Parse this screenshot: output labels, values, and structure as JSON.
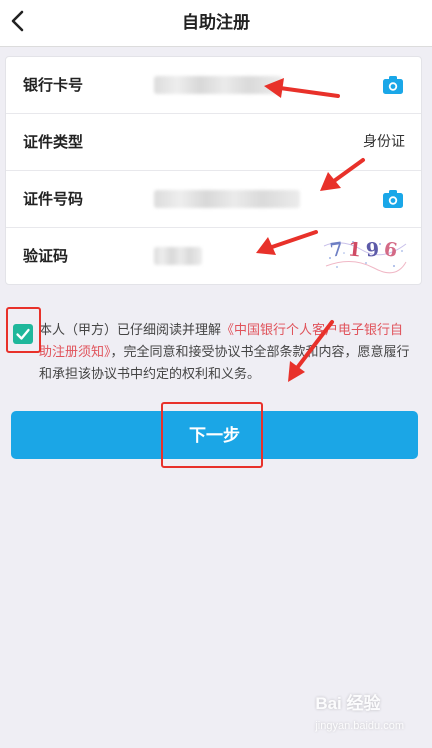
{
  "header": {
    "title": "自助注册",
    "back_icon": "chevron-left-icon"
  },
  "form": {
    "rows": [
      {
        "label": "银行卡号",
        "value": "",
        "icon": "camera-icon"
      },
      {
        "label": "证件类型",
        "value": "身份证"
      },
      {
        "label": "证件号码",
        "value": "",
        "icon": "camera-icon"
      },
      {
        "label": "验证码",
        "value": "",
        "captcha": "7196"
      }
    ]
  },
  "agreement": {
    "checked": true,
    "text_before": "本人（甲方）已仔细阅读并理解",
    "link_text": "《中国银行个人客户电子银行自助注册须知》",
    "text_after": "，完全同意和接受协议书全部条款和内容，愿意履行和承担该协议书中约定的权利和义务。"
  },
  "next_button": {
    "label": "下一步"
  },
  "watermark": {
    "text": "Bai 经验",
    "subtext": "jingyan.baidu.com"
  },
  "colors": {
    "accent": "#1ba6e6",
    "checkbox": "#1fb79b",
    "link": "#e0535b",
    "annotation": "#e8312a",
    "background": "#efeef4"
  }
}
